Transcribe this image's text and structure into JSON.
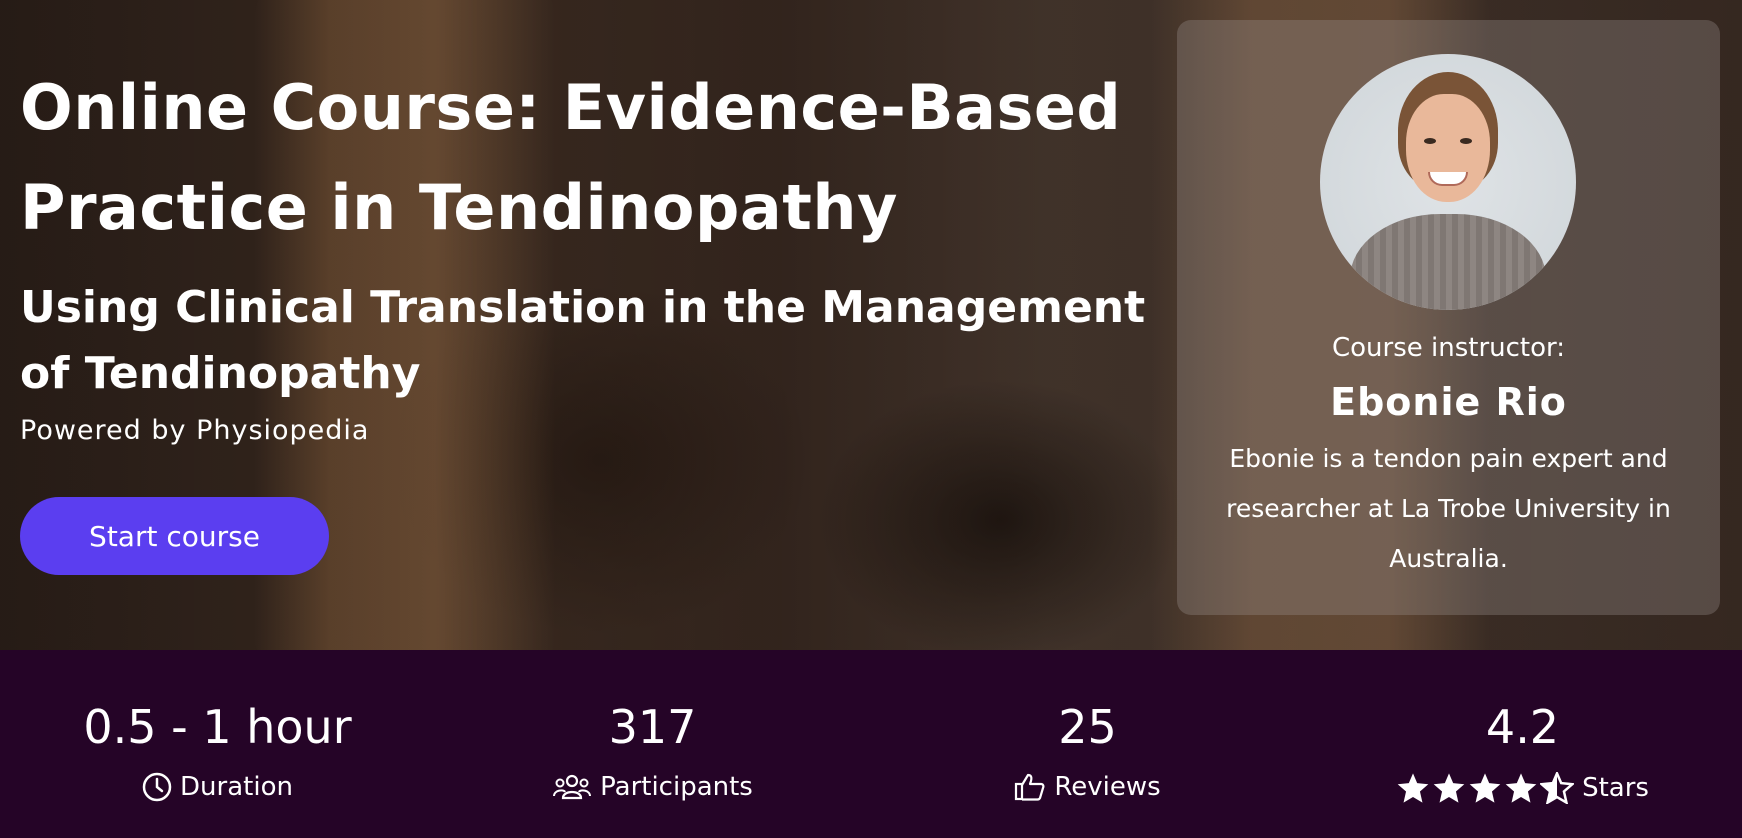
{
  "hero": {
    "title": "Online Course: Evidence-Based Practice in Tendinopathy",
    "subtitle": "Using Clinical Translation in the Management of Tendinopathy",
    "powered_by": "Powered by Physiopedia",
    "start_button": "Start course"
  },
  "instructor": {
    "label": "Course instructor:",
    "name": "Ebonie Rio",
    "bio": "Ebonie is a tendon pain expert and researcher at La Trobe University in Australia."
  },
  "stats": {
    "duration": {
      "value": "0.5 - 1 hour",
      "label": "Duration",
      "icon": "clock-icon"
    },
    "participants": {
      "value": "317",
      "label": "Participants",
      "icon": "users-icon"
    },
    "reviews": {
      "value": "25",
      "label": "Reviews",
      "icon": "thumbs-up-icon"
    },
    "rating": {
      "value": "4.2",
      "label": "Stars",
      "icon": "star-icon",
      "stars_filled": 4.2,
      "stars_total": 5
    }
  },
  "colors": {
    "accent": "#5b3ef0",
    "stats_background": "#250427",
    "text": "#ffffff"
  }
}
